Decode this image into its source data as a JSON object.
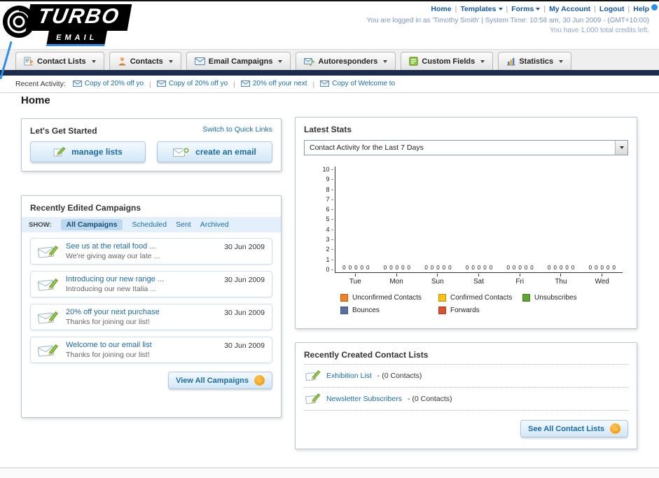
{
  "icons": {
    "arrow_right": "→"
  },
  "header": {
    "logo_line1": "TURBO",
    "logo_line2": "EMAIL",
    "links": [
      {
        "label": "Home",
        "dropdown": false
      },
      {
        "label": "Templates",
        "dropdown": true
      },
      {
        "label": "Forms",
        "dropdown": true
      },
      {
        "label": "My Account",
        "dropdown": false
      },
      {
        "label": "Logout",
        "dropdown": false
      },
      {
        "label": "Help",
        "dropdown": false
      }
    ],
    "login_info": "You are logged in as 'Timothy Smith' | System Time: 10:58 am, 30 Jun 2009 - (GMT+10:00)",
    "credits_info": "You have 1,000 total credits left."
  },
  "nav_tabs": [
    {
      "label": "Contact Lists",
      "icon": "contact-lists-icon"
    },
    {
      "label": "Contacts",
      "icon": "contacts-icon"
    },
    {
      "label": "Email Campaigns",
      "icon": "email-campaigns-icon"
    },
    {
      "label": "Autoresponders",
      "icon": "autoresponders-icon"
    },
    {
      "label": "Custom Fields",
      "icon": "custom-fields-icon"
    },
    {
      "label": "Statistics",
      "icon": "statistics-icon"
    }
  ],
  "recent_activity": {
    "label": "Recent Activity:",
    "items": [
      "Copy of 20% off yo",
      "Copy of 20% off yo",
      "20% off your next",
      "Copy of Welcome to"
    ]
  },
  "page_title": "Home",
  "get_started": {
    "title": "Let's Get Started",
    "switch_link": "Switch to Quick Links",
    "manage_lists_label": "manage lists",
    "create_email_label": "create an email"
  },
  "campaigns": {
    "title": "Recently Edited Campaigns",
    "show_label": "SHOW:",
    "filters": [
      "All Campaigns",
      "Scheduled",
      "Sent",
      "Archived"
    ],
    "selected_filter": "All Campaigns",
    "items": [
      {
        "title": "See us at the retail food ...",
        "subtitle": "We're giving away our late ...",
        "date": "30 Jun 2009"
      },
      {
        "title": "Introducing our new range ...",
        "subtitle": "Introducing our new Italia ...",
        "date": "30 Jun 2009"
      },
      {
        "title": "20% off your next purchase",
        "subtitle": "Thanks for joining our list!",
        "date": "30 Jun 2009"
      },
      {
        "title": "Welcome to our email list",
        "subtitle": "Thanks for joining our list!",
        "date": "30 Jun 2009"
      }
    ],
    "view_all_label": "View All Campaigns"
  },
  "stats": {
    "title": "Latest Stats",
    "dropdown_value": "Contact Activity for the Last 7 Days"
  },
  "chart_data": {
    "type": "bar",
    "title": "Contact Activity for the Last 7 Days",
    "categories": [
      "Tue",
      "Mon",
      "Sun",
      "Sat",
      "Fri",
      "Thu",
      "Wed"
    ],
    "series": [
      {
        "name": "Unconfirmed Contacts",
        "color": "#f58220",
        "values": [
          0,
          0,
          0,
          0,
          0,
          0,
          0
        ]
      },
      {
        "name": "Confirmed Contacts",
        "color": "#fdc216",
        "values": [
          0,
          0,
          0,
          0,
          0,
          0,
          0
        ]
      },
      {
        "name": "Unsubscribes",
        "color": "#61a530",
        "values": [
          0,
          0,
          0,
          0,
          0,
          0,
          0
        ]
      },
      {
        "name": "Bounces",
        "color": "#5572a7",
        "values": [
          0,
          0,
          0,
          0,
          0,
          0,
          0
        ]
      },
      {
        "name": "Forwards",
        "color": "#e04f2b",
        "values": [
          0,
          0,
          0,
          0,
          0,
          0,
          0
        ]
      }
    ],
    "ylim": [
      0,
      10
    ],
    "yticks": [
      0,
      1,
      2,
      3,
      4,
      5,
      6,
      7,
      8,
      9,
      10
    ],
    "grid": false,
    "legend_position": "bottom"
  },
  "contact_lists": {
    "title": "Recently Created Contact Lists",
    "items": [
      {
        "name": "Exhibition List",
        "detail": "- (0 Contacts)"
      },
      {
        "name": "Newsletter Subscribers",
        "detail": "- (0 Contacts)"
      }
    ],
    "see_all_label": "See All Contact Lists"
  }
}
